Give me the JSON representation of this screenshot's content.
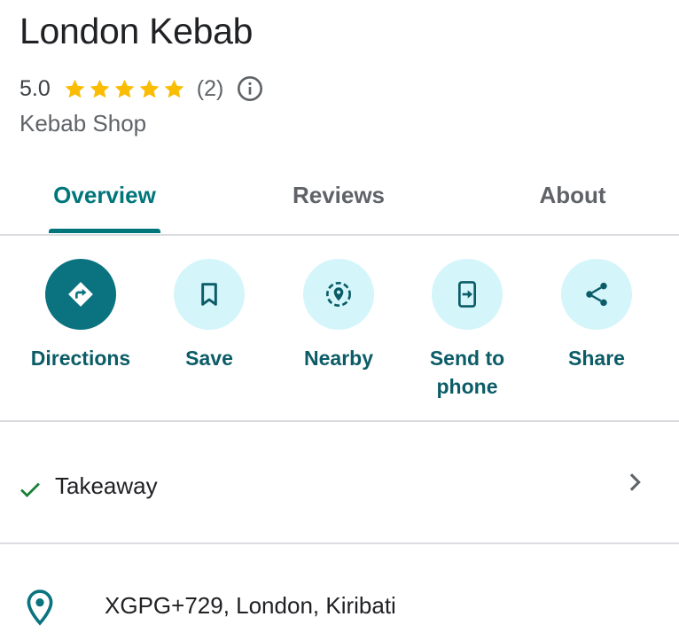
{
  "place": {
    "name": "London Kebab",
    "rating": "5.0",
    "review_count": "(2)",
    "stars": 5,
    "category": "Kebab Shop"
  },
  "tabs": [
    {
      "label": "Overview",
      "active": true
    },
    {
      "label": "Reviews",
      "active": false
    },
    {
      "label": "About",
      "active": false
    }
  ],
  "actions": [
    {
      "label": "Directions",
      "icon": "directions-icon",
      "primary": true
    },
    {
      "label": "Save",
      "icon": "bookmark-icon"
    },
    {
      "label": "Nearby",
      "icon": "nearby-icon"
    },
    {
      "label": "Send to phone",
      "icon": "send-to-phone-icon"
    },
    {
      "label": "Share",
      "icon": "share-icon"
    }
  ],
  "attributes": {
    "label": "Takeaway",
    "icon": "check-icon"
  },
  "address": {
    "text": "XGPG+729, London, Kiribati",
    "icon": "location-pin-icon"
  },
  "colors": {
    "accent": "#00767a",
    "primary_button": "#0b7380",
    "action_bg": "#d4f5fa",
    "star": "#fbbc04",
    "check": "#188038"
  }
}
